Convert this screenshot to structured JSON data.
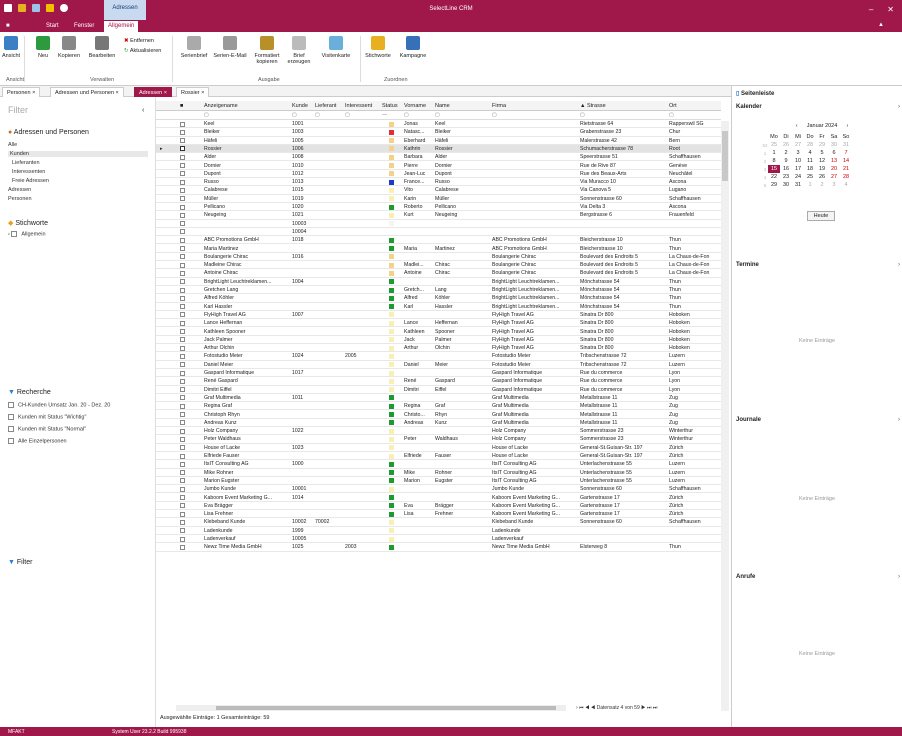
{
  "app": {
    "title": "SelectLine CRM",
    "context_tab": "Adressen"
  },
  "menu": {
    "items": [
      "Start",
      "Fenster",
      "Allgemein"
    ],
    "active": 2
  },
  "ribbon": {
    "buttons": [
      "Ansicht",
      "Neu",
      "Kopieren",
      "Bearbeiten",
      "Entfernen",
      "Aktualisieren",
      "Serienbrief",
      "Serien-E-Mail",
      "Formatiert kopieren",
      "Brief erzeugen",
      "Visitenkarte",
      "Stichworte",
      "Kampagne"
    ],
    "groups": [
      "Ansicht",
      "Verwalten",
      "Ausgabe",
      "Zuordnen"
    ]
  },
  "doc_tabs": [
    "Personen",
    "Adressen und Personen",
    "Adressen",
    "Rossier"
  ],
  "sidebar": {
    "filter": "Filter",
    "section1": "Adressen und Personen",
    "items1": [
      "Alle",
      "Kunden",
      "Lieferanten",
      "Interessenten",
      "Freie Adressen",
      "Adressen",
      "Personen"
    ],
    "selected": "Kunden",
    "section2": "Stichworte",
    "items2": [
      "Allgemein"
    ],
    "section3": "Recherche",
    "items3": [
      "CH-Kunden Umsatz Jan. 20 - Dez. 20",
      "Kunden mit Status \"Wichtig\"",
      "Kunden mit Status \"Normal\"",
      "Alle Einzelpersonen"
    ],
    "section4": "Filter"
  },
  "grid": {
    "columns": [
      "Anzeigename",
      "Kunde",
      "Lieferant",
      "Interessent",
      "Status",
      "Vorname",
      "Name",
      "Firma",
      "Strasse",
      "Ort"
    ],
    "rows": [
      [
        "Keel",
        "1001",
        "",
        "",
        "#f5d28a",
        "Jonas",
        "Keel",
        "",
        "Rietstrasse 64",
        "Rapperswil SG"
      ],
      [
        "Bleiker",
        "1003",
        "",
        "",
        "#e03030",
        "Natasc...",
        "Bleiker",
        "",
        "Grabenstrasse 23",
        "Chur"
      ],
      [
        "Häfeli",
        "1005",
        "",
        "",
        "#f5d28a",
        "Eberhard",
        "Häfeli",
        "",
        "Malerstrasse 42",
        "Bern"
      ],
      [
        "Rossier",
        "1006",
        "",
        "",
        "#f5d28a",
        "Kathrin",
        "Rossier",
        "",
        "Schumacherstrasse 78",
        "Root"
      ],
      [
        "Alder",
        "1008",
        "",
        "",
        "#f5d28a",
        "Barbara",
        "Alder",
        "",
        "Speerstrasse 51",
        "Schaffhausen"
      ],
      [
        "Dornier",
        "1010",
        "",
        "",
        "#f5d28a",
        "Pierre",
        "Dornier",
        "",
        "Rue de Rive 87",
        "Genève"
      ],
      [
        "Dupont",
        "1012",
        "",
        "",
        "#f5d28a",
        "Jean-Luc",
        "Dupont",
        "",
        "Rue des Beaux-Arts",
        "Neuchâtel"
      ],
      [
        "Russo",
        "1013",
        "",
        "",
        "#1a3ad0",
        "France...",
        "Russo",
        "",
        "Via Muracco 10",
        "Ascona"
      ],
      [
        "Calabrese",
        "1015",
        "",
        "",
        "#f8f0b0",
        "Vito",
        "Calabrese",
        "",
        "Via Canova 5",
        "Lugano"
      ],
      [
        "Müller",
        "1019",
        "",
        "",
        "#f8f0b0",
        "Karin",
        "Müller",
        "",
        "Sonnenstrasse 60",
        "Schaffhausen"
      ],
      [
        "Pellicano",
        "1020",
        "",
        "",
        "#1f9a2e",
        "Roberto",
        "Pellicano",
        "",
        "Via Delta 3",
        "Ascona"
      ],
      [
        "Neugeing",
        "1021",
        "",
        "",
        "#f8f0b0",
        "Kurt",
        "Neugeing",
        "",
        "Bergstrasse 6",
        "Frauenfeld"
      ],
      [
        "",
        "10003",
        "",
        "",
        "#f4f4f4",
        "",
        "",
        "",
        "",
        ""
      ],
      [
        "",
        "10004",
        "",
        "",
        "",
        "",
        "",
        "",
        "",
        ""
      ],
      [
        "ABC Promotions GmbH",
        "1018",
        "",
        "",
        "#1f9a2e",
        "",
        "",
        "ABC Promotions GmbH",
        "Bleicherstrasse 10",
        "Thun"
      ],
      [
        "Maria Martinez",
        "",
        "",
        "",
        "#1f9a2e",
        "Maria",
        "Martinez",
        "ABC Promotions GmbH",
        "Bleicherstrasse 10",
        "Thun"
      ],
      [
        "Boulangerie Chirac",
        "1016",
        "",
        "",
        "#f5d28a",
        "",
        "",
        "Boulangerie Chirac",
        "Boulevard des Endroits 5",
        "La Chaux-de-Fon"
      ],
      [
        "Madleine Chirac",
        "",
        "",
        "",
        "#f5d28a",
        "Madlei...",
        "Chirac",
        "Boulangerie Chirac",
        "Boulevard des Endroits 5",
        "La Chaux-de-Fon"
      ],
      [
        "Antoine Chirac",
        "",
        "",
        "",
        "#f5d28a",
        "Antoine",
        "Chirac",
        "Boulangerie Chirac",
        "Boulevard des Endroits 5",
        "La Chaux-de-Fon"
      ],
      [
        "BrightLight Leuchtreklamen...",
        "1004",
        "",
        "",
        "#1f9a2e",
        "",
        "",
        "BrightLight Leuchtreklamen...",
        "Mönchstrasse 54",
        "Thun"
      ],
      [
        "Gretchen Lang",
        "",
        "",
        "",
        "#1f9a2e",
        "Gretch...",
        "Lang",
        "BrightLight Leuchtreklamen...",
        "Mönchstrasse 54",
        "Thun"
      ],
      [
        "Alfred Köhler",
        "",
        "",
        "",
        "#1f9a2e",
        "Alfred",
        "Köhler",
        "BrightLight Leuchtreklamen...",
        "Mönchstrasse 54",
        "Thun"
      ],
      [
        "Karl Hassler",
        "",
        "",
        "",
        "#1f9a2e",
        "Karl",
        "Hassler",
        "BrightLight Leuchtreklamen...",
        "Mönchstrasse 54",
        "Thun"
      ],
      [
        "FlyHigh Travel AG",
        "1007",
        "",
        "",
        "#f8f0b0",
        "",
        "",
        "FlyHigh Travel AG",
        "Sinatra Dr 800",
        "Hoboken"
      ],
      [
        "Lance Heffernan",
        "",
        "",
        "",
        "#f8f0b0",
        "Lance",
        "Heffernan",
        "FlyHigh Travel AG",
        "Sinatra Dr 800",
        "Hoboken"
      ],
      [
        "Kathleen Spooner",
        "",
        "",
        "",
        "#f8f0b0",
        "Kathleen",
        "Spooner",
        "FlyHigh Travel AG",
        "Sinatra Dr 800",
        "Hoboken"
      ],
      [
        "Jack Palmer",
        "",
        "",
        "",
        "#f8f0b0",
        "Jack",
        "Palmer",
        "FlyHigh Travel AG",
        "Sinatra Dr 800",
        "Hoboken"
      ],
      [
        "Arthur Olchin",
        "",
        "",
        "",
        "#f8f0b0",
        "Arthur",
        "Olchin",
        "FlyHigh Travel AG",
        "Sinatra Dr 800",
        "Hoboken"
      ],
      [
        "Fotostudio Meier",
        "1024",
        "",
        "2005",
        "#f8f0b0",
        "",
        "",
        "Fotostudio Meier",
        "Tribschenstrasse 72",
        "Luzern"
      ],
      [
        "Daniel Meier",
        "",
        "",
        "",
        "#f8f0b0",
        "Daniel",
        "Meier",
        "Fotostudio Meier",
        "Tribschenstrasse 72",
        "Luzern"
      ],
      [
        "Gaspard Informatique",
        "1017",
        "",
        "",
        "#f8f0b0",
        "",
        "",
        "Gaspard Informatique",
        "Rue du commerce",
        "Lyon"
      ],
      [
        "René Gaspard",
        "",
        "",
        "",
        "#f8f0b0",
        "René",
        "Gaspard",
        "Gaspard Informatique",
        "Rue du commerce",
        "Lyon"
      ],
      [
        "Dimitri Eiffel",
        "",
        "",
        "",
        "#f8f0b0",
        "Dimitri",
        "Eiffel",
        "Gaspard Informatique",
        "Rue du commerce",
        "Lyon"
      ],
      [
        "Graf Multimedia",
        "1011",
        "",
        "",
        "#1f9a2e",
        "",
        "",
        "Graf Multimedia",
        "Metallstrasse 11",
        "Zug"
      ],
      [
        "Regina Graf",
        "",
        "",
        "",
        "#1f9a2e",
        "Regina",
        "Graf",
        "Graf Multimedia",
        "Metallstrasse 11",
        "Zug"
      ],
      [
        "Christoph Rhyn",
        "",
        "",
        "",
        "#1f9a2e",
        "Christo...",
        "Rhyn",
        "Graf Multimedia",
        "Metallstrasse 11",
        "Zug"
      ],
      [
        "Andreas Kunz",
        "",
        "",
        "",
        "#1f9a2e",
        "Andreas",
        "Kunz",
        "Graf Multimedia",
        "Metallstrasse 11",
        "Zug"
      ],
      [
        "Holz Company",
        "1022",
        "",
        "",
        "#f8f0b0",
        "",
        "",
        "Holz Company",
        "Sommerstrasse 23",
        "Winterthur"
      ],
      [
        "Peter Waldhaus",
        "",
        "",
        "",
        "#f8f0b0",
        "Peter",
        "Waldhaus",
        "Holz Company",
        "Sommerstrasse 23",
        "Winterthur"
      ],
      [
        "House of Lacke",
        "1023",
        "",
        "",
        "#f8f0b0",
        "",
        "",
        "House of Lacke",
        "General-St.Guisan-Str. 197",
        "Zürich"
      ],
      [
        "Elfriede Fauser",
        "",
        "",
        "",
        "#f8f0b0",
        "Elfriede",
        "Fauser",
        "House of Lacke",
        "General-St.Guisan-Str. 197",
        "Zürich"
      ],
      [
        "ItsIT Consulting AG",
        "1000",
        "",
        "",
        "#1f9a2e",
        "",
        "",
        "ItsIT Consulting AG",
        "Unterlachenstrasse 55",
        "Luzern"
      ],
      [
        "Mike Rohner",
        "",
        "",
        "",
        "#1f9a2e",
        "Mike",
        "Rohner",
        "ItsIT Consulting AG",
        "Unterlachenstrasse 55",
        "Luzern"
      ],
      [
        "Marion Eugster",
        "",
        "",
        "",
        "#1f9a2e",
        "Marion",
        "Eugster",
        "ItsIT Consulting AG",
        "Unterlachenstrasse 55",
        "Luzern"
      ],
      [
        "Jumbo Kunde",
        "10001",
        "",
        "",
        "#f8f0b0",
        "",
        "",
        "Jumbo Kunde",
        "Sonnenstrasse 60",
        "Schaffhausen"
      ],
      [
        "Kaboom Event Marketing G...",
        "1014",
        "",
        "",
        "#1f9a2e",
        "",
        "",
        "Kaboom Event Marketing G...",
        "Gartenstrasse 17",
        "Zürich"
      ],
      [
        "Eva Brägger",
        "",
        "",
        "",
        "#1f9a2e",
        "Eva",
        "Brägger",
        "Kaboom Event Marketing G...",
        "Gartenstrasse 17",
        "Zürich"
      ],
      [
        "Lisa Frehner",
        "",
        "",
        "",
        "#1f9a2e",
        "Lisa",
        "Frehner",
        "Kaboom Event Marketing G...",
        "Gartenstrasse 17",
        "Zürich"
      ],
      [
        "Klebeband Kunde",
        "10002",
        "70002",
        "",
        "#f8f0b0",
        "",
        "",
        "Klebeband Kunde",
        "Sonnenstrasse 60",
        "Schaffhausen"
      ],
      [
        "Ladenkunde",
        "1999",
        "",
        "",
        "#f8f0b0",
        "",
        "",
        "Ladenkunde",
        "",
        ""
      ],
      [
        "Ladenverkauf",
        "10005",
        "",
        "",
        "#f8f0b0",
        "",
        "",
        "Ladenverkauf",
        "",
        ""
      ],
      [
        "Newz Time Media GmbH",
        "1025",
        "",
        "2003",
        "#1f9a2e",
        "",
        "",
        "Newz Time Media GmbH",
        "Elsterweg 8",
        "Thun"
      ]
    ],
    "selected_index": 3,
    "footer": "Ausgewählte Einträge: 1   Gesamteinträge: 59",
    "nav": "Datensatz 4 von 59"
  },
  "right": {
    "title": "Seitenleiste",
    "calendar_title": "Kalender",
    "month": "Januar 2024",
    "weekdays": [
      "Mo",
      "Di",
      "Mi",
      "Do",
      "Fr",
      "Sa",
      "So"
    ],
    "button": "Heute",
    "termine": "Termine",
    "journale": "Journale",
    "anrufe": "Anrufe",
    "empty": "Keine Einträge"
  },
  "status": {
    "left": "MFAKT",
    "mid": "System User 23.2.2 Build 995938"
  }
}
